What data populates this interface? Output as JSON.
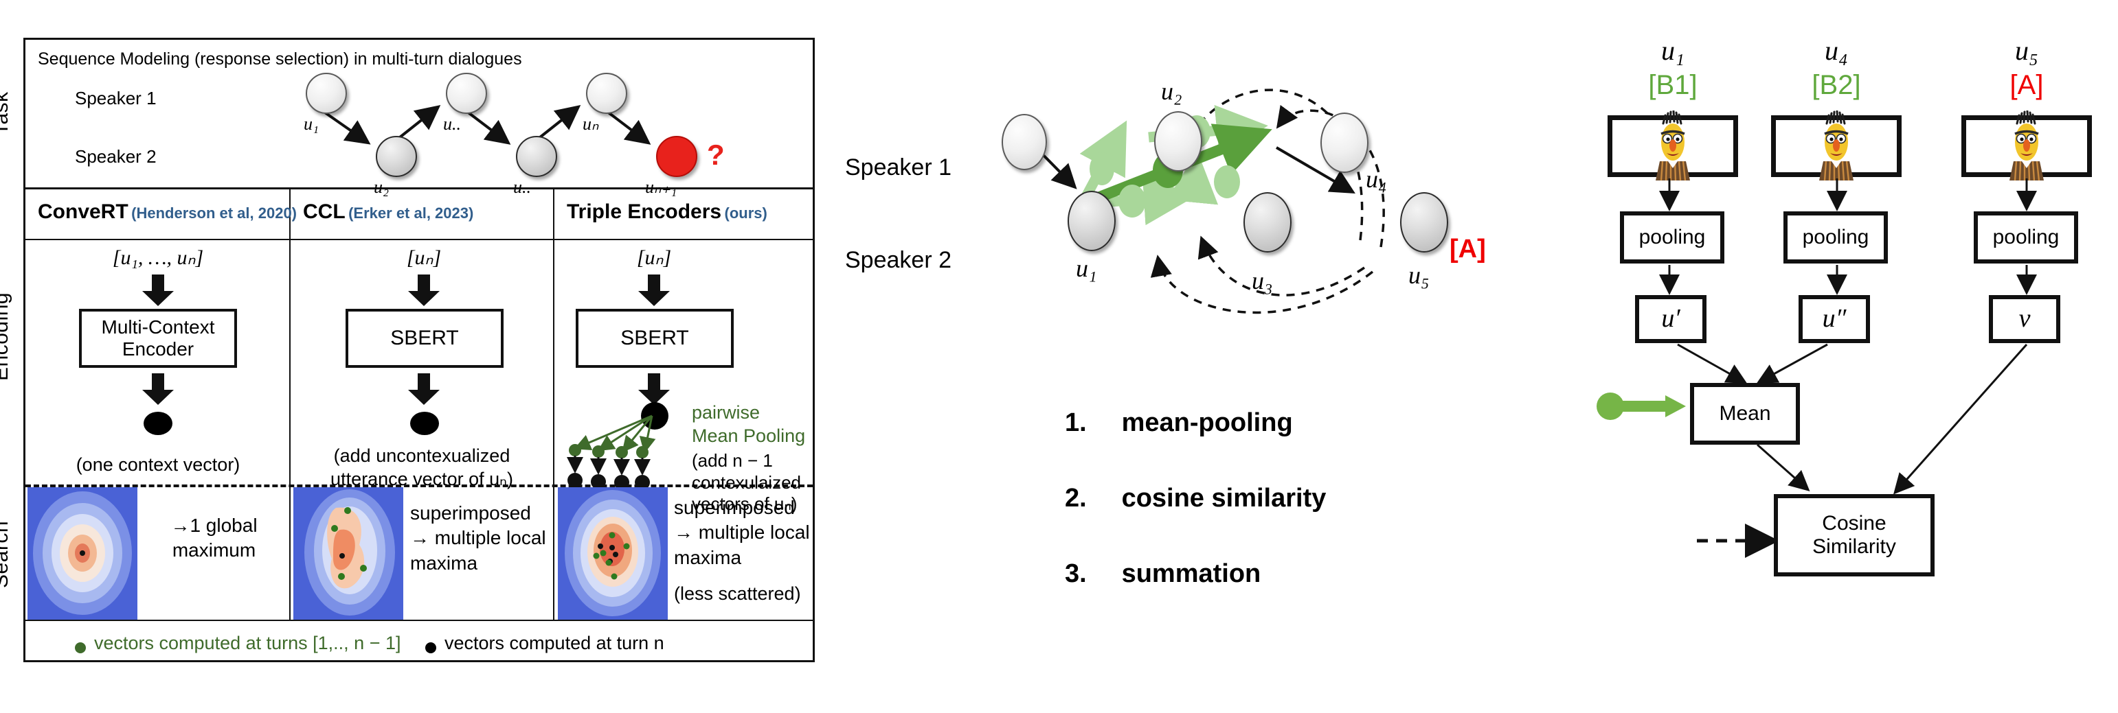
{
  "left_panel": {
    "row_labels": {
      "task": "Task",
      "encoding": "Encoding",
      "search": "Search"
    },
    "task": {
      "title": "Sequence Modeling (response selection) in multi-turn dialogues",
      "speaker1": "Speaker 1",
      "speaker2": "Speaker 2",
      "nodes": [
        {
          "label": "u₁",
          "speaker": 1
        },
        {
          "label": "u₂",
          "speaker": 2
        },
        {
          "label": "u..",
          "speaker": 1
        },
        {
          "label": "u..",
          "speaker": 2
        },
        {
          "label": "uₙ",
          "speaker": 1
        },
        {
          "label": "uₙ₊₁",
          "speaker": 2
        }
      ],
      "question_mark": "?"
    },
    "columns": [
      {
        "title": "ConveRT",
        "citation": "(Henderson et al, 2020)",
        "input": "[u₁, …, uₙ]",
        "encoder_box": "Multi-Context Encoder",
        "caption": "(one context vector)",
        "search_caption": "→1 global maximum"
      },
      {
        "title": "CCL",
        "citation": "(Erker et al, 2023)",
        "input": "[uₙ]",
        "encoder_box": "SBERT",
        "caption": "(add uncontexualized utterance vector of uₙ)",
        "search_caption": "superimposed → multiple local maxima"
      },
      {
        "title": "Triple Encoders",
        "citation": "(ours)",
        "input": "[uₙ]",
        "encoder_box": "SBERT",
        "pooling_label_line1": "pairwise",
        "pooling_label_line2": "Mean Pooling",
        "caption": "(add n − 1 contexulaized vectors of uₙ)",
        "search_caption": "superimposed → multiple local maxima",
        "search_caption_extra": "(less scattered)"
      }
    ],
    "legend": [
      {
        "marker_color": "#3f6b2b",
        "text": "vectors computed at turns [1,.., n − 1]"
      },
      {
        "marker_color": "#000000",
        "text": "vectors computed at turn n"
      }
    ]
  },
  "middle_panel": {
    "speaker1": "Speaker 1",
    "speaker2": "Speaker 2",
    "node_labels": [
      "u₁",
      "u₂",
      "u₃",
      "u₄",
      "u₅"
    ],
    "answer_tag": "[A]",
    "steps": [
      {
        "num": "1.",
        "text": "mean-pooling"
      },
      {
        "num": "2.",
        "text": "cosine similarity"
      },
      {
        "num": "3.",
        "text": "summation"
      }
    ]
  },
  "right_panel": {
    "columns": [
      {
        "u_label": "u₁",
        "tag": "[B1]",
        "tag_color": "#5fa83c",
        "pooling": "pooling",
        "vector": "u′"
      },
      {
        "u_label": "u₄",
        "tag": "[B2]",
        "tag_color": "#5fa83c",
        "pooling": "pooling",
        "vector": "u″"
      },
      {
        "u_label": "u₅",
        "tag": "[A]",
        "tag_color": "#ef0000",
        "pooling": "pooling",
        "vector": "v"
      }
    ],
    "mean_box": "Mean",
    "cosine_box_line1": "Cosine",
    "cosine_box_line2": "Similarity"
  },
  "colors": {
    "citation_blue": "#315e8c",
    "green": "#5fa83c",
    "dark_green": "#3f6b2b",
    "red": "#ef0000",
    "heat_bg": "#4a62d6"
  }
}
